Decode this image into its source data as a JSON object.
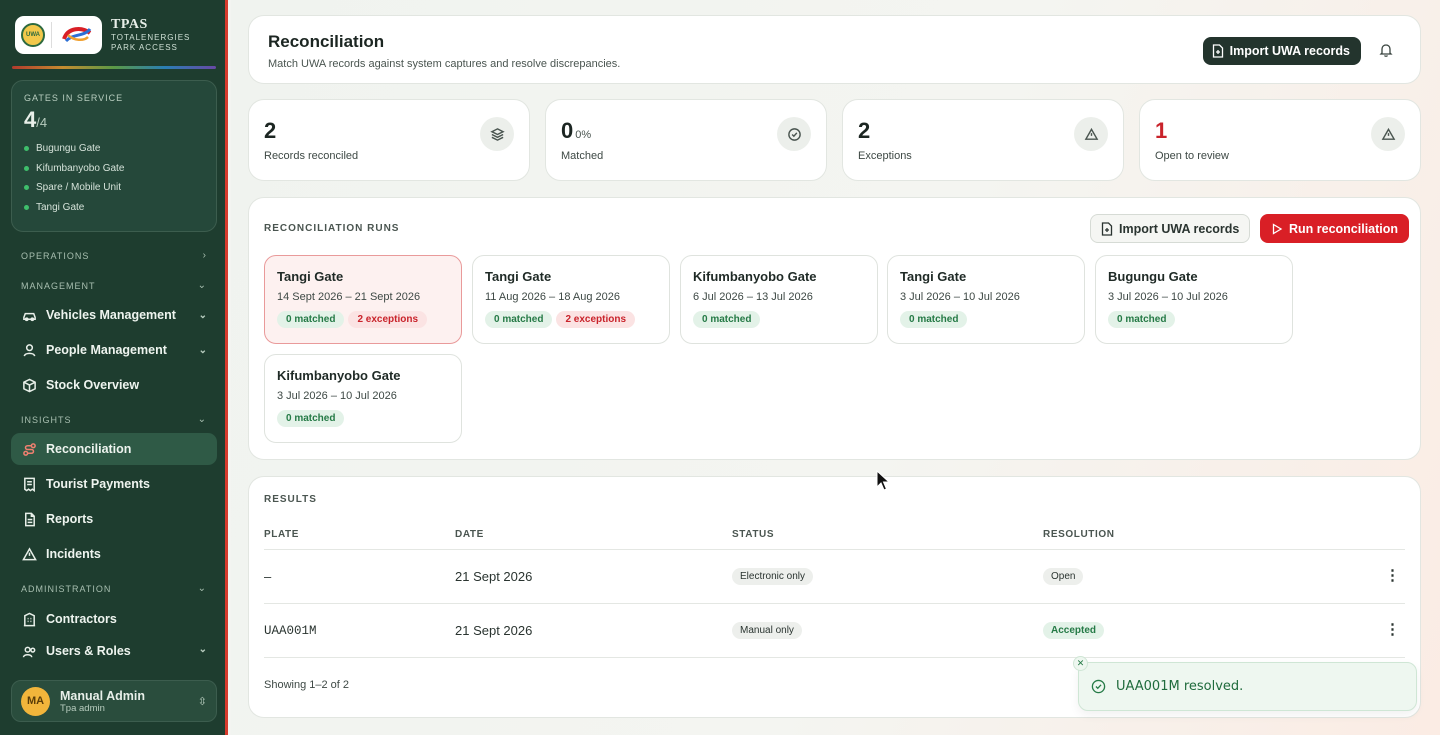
{
  "brand": {
    "title": "TPAS",
    "sub1": "TOTALENERGIES",
    "sub2": "PARK ACCESS",
    "uwa": "UWA"
  },
  "gates": {
    "label": "GATES IN SERVICE",
    "count": "4",
    "total": "/4",
    "items": [
      "Bugungu Gate",
      "Kifumbanyobo Gate",
      "Spare / Mobile Unit",
      "Tangi Gate"
    ]
  },
  "nav": {
    "operations": "OPERATIONS",
    "management": "MANAGEMENT",
    "vehicles": "Vehicles Management",
    "people": "People Management",
    "stock": "Stock Overview",
    "insights": "INSIGHTS",
    "reconciliation": "Reconciliation",
    "payments": "Tourist Payments",
    "reports": "Reports",
    "incidents": "Incidents",
    "administration": "ADMINISTRATION",
    "contractors": "Contractors",
    "users": "Users & Roles"
  },
  "user": {
    "initials": "MA",
    "name": "Manual Admin",
    "role": "Tpa admin"
  },
  "header": {
    "title": "Reconciliation",
    "subtitle": "Match UWA records against system captures and resolve discrepancies.",
    "import_label": "Import UWA records"
  },
  "stats": [
    {
      "value": "2",
      "suffix": "",
      "label": "Records reconciled",
      "icon": "layers-icon"
    },
    {
      "value": "0",
      "suffix": "0%",
      "label": "Matched",
      "icon": "check-circle-icon"
    },
    {
      "value": "2",
      "suffix": "",
      "label": "Exceptions",
      "icon": "alert-triangle-icon"
    },
    {
      "value": "1",
      "suffix": "",
      "label": "Open to review",
      "icon": "alert-triangle-icon"
    }
  ],
  "runs": {
    "label": "RECONCILIATION RUNS",
    "import_label": "Import UWA records",
    "run_label": "Run reconciliation",
    "items": [
      {
        "gate": "Tangi Gate",
        "dates": "14 Sept 2026 – 21 Sept 2026",
        "matched": "0 matched",
        "exceptions": "2 exceptions"
      },
      {
        "gate": "Tangi Gate",
        "dates": "11 Aug 2026 – 18 Aug 2026",
        "matched": "0 matched",
        "exceptions": "2 exceptions"
      },
      {
        "gate": "Kifumbanyobo Gate",
        "dates": "6 Jul 2026 – 13 Jul 2026",
        "matched": "0 matched"
      },
      {
        "gate": "Tangi Gate",
        "dates": "3 Jul 2026 – 10 Jul 2026",
        "matched": "0 matched"
      },
      {
        "gate": "Bugungu Gate",
        "dates": "3 Jul 2026 – 10 Jul 2026",
        "matched": "0 matched"
      },
      {
        "gate": "Kifumbanyobo Gate",
        "dates": "3 Jul 2026 – 10 Jul 2026",
        "matched": "0 matched"
      }
    ]
  },
  "results": {
    "label": "RESULTS",
    "columns": [
      "PLATE",
      "DATE",
      "STATUS",
      "RESOLUTION"
    ],
    "rows": [
      {
        "plate": "–",
        "date": "21 Sept 2026",
        "status": "Electronic only",
        "resolution": "Open"
      },
      {
        "plate": "UAA001M",
        "date": "21 Sept 2026",
        "status": "Manual only",
        "resolution": "Accepted"
      }
    ],
    "showing": "Showing 1–2 of 2"
  },
  "toast": {
    "message": "UAA001M resolved."
  },
  "colors": {
    "sidebar": "#1e3d2f",
    "accent_red": "#d91f26",
    "dark_button": "#23342d",
    "success": "#257a46"
  }
}
